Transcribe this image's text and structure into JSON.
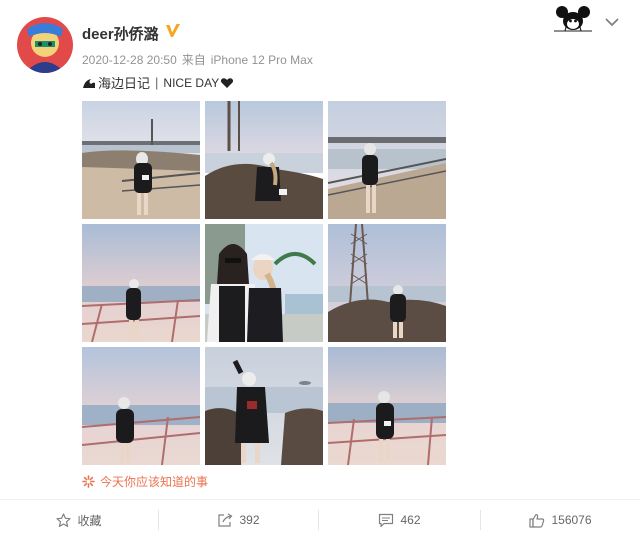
{
  "post": {
    "username": "deer孙侨潞",
    "timestamp": "2020-12-28 20:50",
    "via_label": "来自",
    "device": "iPhone 12 Pro Max",
    "text_main": "海边日记",
    "text_separator": "|",
    "text_tag": "NICE DAY",
    "source_label": "今天你应该知道的事"
  },
  "icons": {
    "verified": "verified-v-badge",
    "more": "chevron-down",
    "wave": "wave-emoji",
    "heart": "black-heart-emoji"
  },
  "photos": [
    {
      "scene": "pier-standing"
    },
    {
      "scene": "rock-sitting"
    },
    {
      "scene": "railing-standing"
    },
    {
      "scene": "sunset-railing"
    },
    {
      "scene": "selfie-two"
    },
    {
      "scene": "rock-tower"
    },
    {
      "scene": "railing-standing-2"
    },
    {
      "scene": "rock-close"
    },
    {
      "scene": "railing-sunset-2"
    }
  ],
  "footer": {
    "favorite_label": "收藏",
    "repost_count": "392",
    "comment_count": "462",
    "like_count": "156076"
  },
  "colors": {
    "source_text": "#eb7350",
    "verified": "#f5a623",
    "meta_text": "#939393"
  }
}
